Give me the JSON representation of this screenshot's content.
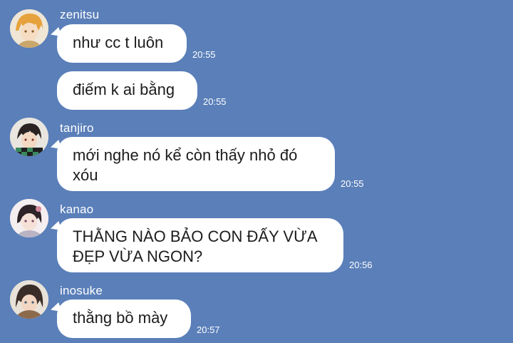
{
  "messages": [
    {
      "sender": "zenitsu",
      "text": "như cc t luôn",
      "time": "20:55"
    },
    {
      "sender": "",
      "text": "điếm k ai bằng",
      "time": "20:55"
    },
    {
      "sender": "tanjiro",
      "text": "mới nghe nó kể còn thấy nhỏ đó xóu",
      "line1": "mới nghe nó kể còn thấy nhỏ đó",
      "line2": "xóu",
      "time": "20:55"
    },
    {
      "sender": "kanao",
      "text": "THẰNG NÀO BẢO CON ĐẤY VỪA ĐẸP VỪA NGON?",
      "line1": "THẰNG NÀO BẢO CON ĐẤY VỪA",
      "line2": "ĐẸP VỪA NGON?",
      "time": "20:56"
    },
    {
      "sender": "inosuke",
      "text": "thằng bồ mày",
      "time": "20:57"
    }
  ],
  "avatars": [
    {
      "icon": "zenitsu-avatar-icon",
      "color": "#e0a14a"
    },
    {
      "icon": "tanjiro-avatar-icon",
      "color": "#2b2b2b"
    },
    {
      "icon": "kanao-avatar-icon",
      "color": "#c98c9c"
    },
    {
      "icon": "inosuke-avatar-icon",
      "color": "#6b4a36"
    }
  ],
  "colors": {
    "background": "#5a7fb9",
    "bubble": "#ffffff",
    "text": "#1c1c1c"
  }
}
